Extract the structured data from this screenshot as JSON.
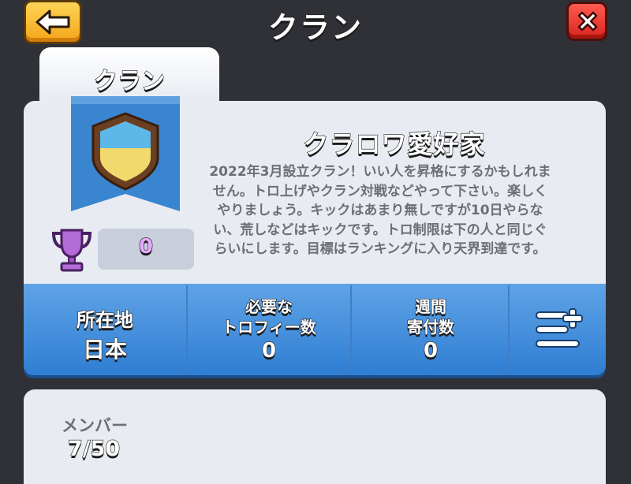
{
  "header": {
    "title": "クラン",
    "back_icon": "back-arrow-icon",
    "close_icon": "close-icon"
  },
  "tabs": [
    {
      "label": "クラン"
    }
  ],
  "clan": {
    "name": "クラロワ愛好家",
    "description": "2022年3月設立クラン！いい人を昇格にするかもしれません。トロ上げやクラン対戦などやって下さい。楽しくやりましょう。キックはあまり無しですが10日やらない、荒しなどはキックです。トロ制限は下の人と同じぐらいにします。目標はランキングに入り天界到達です。",
    "trophies": "0"
  },
  "stats": {
    "location_label": "所在地",
    "location_value": "日本",
    "required_trophies_label_1": "必要な",
    "required_trophies_label_2": "トロフィー数",
    "required_trophies_value": "0",
    "weekly_donations_label_1": "週間",
    "weekly_donations_label_2": "寄付数",
    "weekly_donations_value": "0"
  },
  "members": {
    "label": "メンバー",
    "count": "7/50"
  },
  "colors": {
    "back_button": "#f3a51a",
    "close_button": "#d8251d",
    "stats_bar": "#2f7ed3",
    "trophy_count": "#e6a7ff",
    "banner": "#3a85d0"
  }
}
